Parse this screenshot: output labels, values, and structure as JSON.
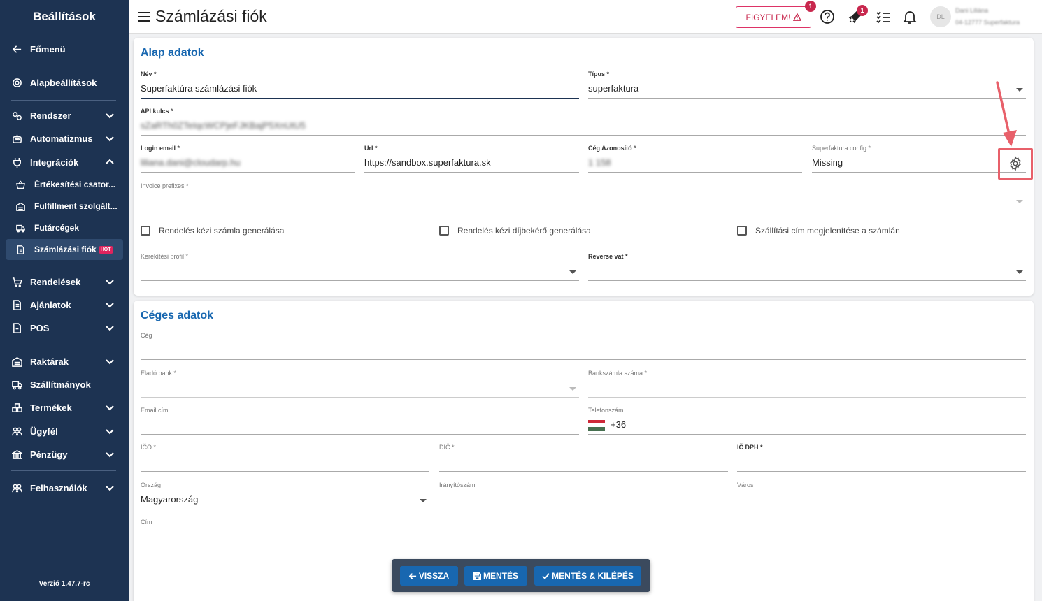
{
  "sidebar": {
    "title": "Beállítások",
    "items": {
      "fomenu": "Főmenü",
      "alapbeallitasok": "Alapbeállítások",
      "rendszer": "Rendszer",
      "automatizmus": "Automatizmus",
      "integraciok": "Integrációk",
      "ertekesitesi": "Értékesítési csator...",
      "fulfillment": "Fulfillment szolgált...",
      "futarcegek": "Futárcégek",
      "szamlazasi": "Számlázási fiók",
      "rendelesek": "Rendelések",
      "ajanlatok": "Ajánlatok",
      "pos": "POS",
      "raktarak": "Raktárak",
      "szallitmanyok": "Szállítmányok",
      "termekek": "Termékek",
      "ugyfel": "Ügyfél",
      "penzugy": "Pénzügy",
      "felhasznalok": "Felhasználók"
    },
    "hot_badge": "HOT",
    "version": "Verzió 1.47.7-rc"
  },
  "header": {
    "title": "Számlázási fiók",
    "figyelem": "FIGYELEM!",
    "figyelem_badge": "1",
    "rocket_badge": "1",
    "avatar_text": "DL",
    "user_name": "Dani Liliána",
    "user_sub": "04-12777 Superfaktura"
  },
  "alap": {
    "title": "Alap adatok",
    "nev_label": "Név *",
    "nev_value": "Superfaktúra számlázási fiók",
    "tipus_label": "Típus *",
    "tipus_value": "superfaktura",
    "api_label": "API kulcs *",
    "api_value": "sZaRTh0ZTeIqcWCPjeFJKBajP5XnUtU5",
    "login_label": "Login email *",
    "login_value": "liliana.dani@cloudarp.hu",
    "url_label": "Url *",
    "url_value": "https://sandbox.superfaktura.sk",
    "ceg_az_label": "Cég Azonosító *",
    "ceg_az_value": "1 158",
    "sf_config_label": "Superfaktura config *",
    "sf_config_value": "Missing",
    "invoice_label": "Invoice prefixes *",
    "cb1": "Rendelés kézi számla generálása",
    "cb2": "Rendelés kézi díjbekérő generálása",
    "cb3": "Szállítási cím megjelenítése a számlán",
    "kerek_label": "Kerekítési profil *",
    "reverse_label": "Reverse vat *"
  },
  "ceges": {
    "title": "Céges adatok",
    "ceg_label": "Cég",
    "elado_bank_label": "Eladó bank *",
    "bankszamla_label": "Bankszámla száma *",
    "email_label": "Email cím",
    "telefon_label": "Telefonszám",
    "telefon_value": "+36",
    "ico_label": "IČO *",
    "dic_label": "DIČ *",
    "icdph_label": "IČ DPH *",
    "orszag_label": "Ország",
    "orszag_value": "Magyarország",
    "irsz_label": "Irányítószám",
    "varos_label": "Város",
    "cim_label": "Cím"
  },
  "actions": {
    "vissza": "VISSZA",
    "mentes": "MENTÉS",
    "mentes_kilepes": "MENTÉS & KILÉPÉS"
  },
  "colors": {
    "sidebar_bg": "#1d3352",
    "accent": "#1867b0",
    "alert": "#c8284e",
    "highlight": "#e8606a"
  }
}
